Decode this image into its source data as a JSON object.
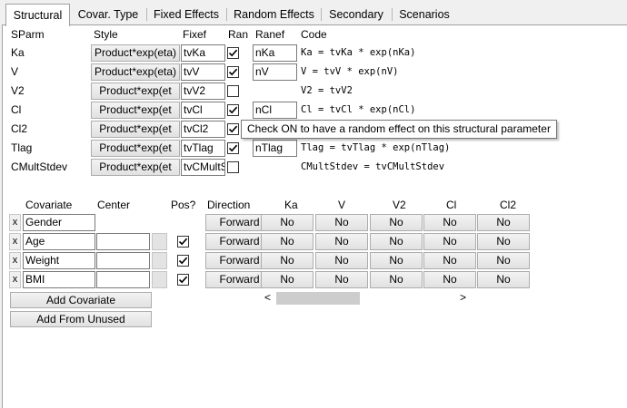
{
  "tabs": [
    "Structural",
    "Covar. Type",
    "Fixed Effects",
    "Random Effects",
    "Secondary",
    "Scenarios"
  ],
  "params_headers": {
    "sparm": "SParm",
    "style": "Style",
    "fixef": "Fixef",
    "ran": "Ran",
    "ranef": "Ranef",
    "code": "Code"
  },
  "params": [
    {
      "name": "Ka",
      "style": "Product*exp(eta)",
      "fixef": "tvKa",
      "ran": true,
      "ranef": "nKa",
      "code": "Ka = tvKa * exp(nKa)"
    },
    {
      "name": "V",
      "style": "Product*exp(eta)",
      "fixef": "tvV",
      "ran": true,
      "ranef": "nV",
      "code": "V = tvV * exp(nV)"
    },
    {
      "name": "V2",
      "style": "Product*exp(et",
      "fixef": "tvV2",
      "ran": false,
      "ranef": "",
      "code": "V2 = tvV2"
    },
    {
      "name": "Cl",
      "style": "Product*exp(et",
      "fixef": "tvCl",
      "ran": true,
      "ranef": "nCl",
      "code": "Cl = tvCl * exp(nCl)"
    },
    {
      "name": "Cl2",
      "style": "Product*exp(et",
      "fixef": "tvCl2",
      "ran": true,
      "ranef": "",
      "code": ""
    },
    {
      "name": "Tlag",
      "style": "Product*exp(et",
      "fixef": "tvTlag",
      "ran": true,
      "ranef": "nTlag",
      "code": "Tlag = tvTlag * exp(nTlag)"
    },
    {
      "name": "CMultStdev",
      "style": "Product*exp(et",
      "fixef": "tvCMultSt",
      "ran": false,
      "ranef": "",
      "code": "CMultStdev = tvCMultStdev"
    }
  ],
  "tooltip": "Check ON to have a random effect on this structural parameter",
  "cov_headers": {
    "covariate": "Covariate",
    "center": "Center",
    "pos": "Pos?",
    "direction": "Direction",
    "params": [
      "Ka",
      "V",
      "V2",
      "Cl",
      "Cl2"
    ]
  },
  "covariates": [
    {
      "remove": "x",
      "name": "Gender",
      "center": "",
      "has_pos": false,
      "pos": false,
      "direction": "Forward",
      "effects": [
        "No",
        "No",
        "No",
        "No",
        "No"
      ]
    },
    {
      "remove": "x",
      "name": "Age",
      "center": "",
      "has_pos": true,
      "pos": true,
      "direction": "Forward",
      "effects": [
        "No",
        "No",
        "No",
        "No",
        "No"
      ]
    },
    {
      "remove": "x",
      "name": "Weight",
      "center": "",
      "has_pos": true,
      "pos": true,
      "direction": "Forward",
      "effects": [
        "No",
        "No",
        "No",
        "No",
        "No"
      ]
    },
    {
      "remove": "x",
      "name": "BMI",
      "center": "",
      "has_pos": true,
      "pos": true,
      "direction": "Forward",
      "effects": [
        "No",
        "No",
        "No",
        "No",
        "No"
      ]
    }
  ],
  "buttons": {
    "add_covariate": "Add Covariate",
    "add_from_unused": "Add From Unused"
  },
  "scroll": {
    "left": "<",
    "right": ">"
  },
  "colors": {
    "active_tab": "#ffffff",
    "background": "#f0f0f0",
    "button_border": "#adadad"
  }
}
